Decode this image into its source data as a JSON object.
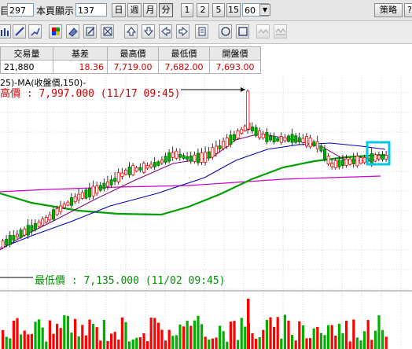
{
  "toolbar": {
    "count_value": "297",
    "page_show_label": "本頁顯示",
    "page_show_value": "137",
    "period_day": "日",
    "period_week": "週",
    "period_month": "月",
    "period_minute": "分",
    "minute_options": [
      "1",
      "2",
      "5",
      "15"
    ],
    "minute_select_value": "60",
    "strategy_label": "策略",
    "help_label": "?"
  },
  "drawing_tools": [
    "bar-chart-icon",
    "pencil-line-icon",
    "pencil-draw-icon",
    "color-palette-icon",
    "eraser-icon",
    "edit-icon",
    "cross-box-icon",
    "arrow-up-icon",
    "arrow-down-icon",
    "arrow-left-icon",
    "arrow-right-icon",
    "document-icon",
    "circle-icon",
    "square-icon",
    "wave-icon-1",
    "wave-icon-2"
  ],
  "stats": {
    "headers": [
      "交易量",
      "基差",
      "最高價",
      "最低價",
      "開盤價"
    ],
    "values": [
      "21,880",
      "18.36",
      "7,719.00",
      "7,682.00",
      "7,693.00"
    ],
    "value_colors": [
      "#000000",
      "#d60000",
      "#d60000",
      "#d60000",
      "#d60000"
    ]
  },
  "chart": {
    "ma_label": "25)-MA(收盤價,150)-",
    "high_label": "高價 : 7,997.000 (11/17 09:45)",
    "low_label": "最低價 : 7,135.000 (11/02 09:45)"
  },
  "colors": {
    "up": "#ff0000",
    "down": "#00b000",
    "ma_short": "#800080",
    "ma_mid": "#0000c0",
    "ma_long": "#00a000",
    "ma_longest": "#d000d0",
    "highlight": "#00c8e8"
  },
  "chart_data": {
    "type": "candlestick",
    "series": [
      {
        "name": "MA(收盤價,150)",
        "values": []
      }
    ],
    "high": {
      "value": 7997.0,
      "time": "11/17 09:45"
    },
    "low": {
      "value": 7135.0,
      "time": "11/02 09:45"
    },
    "grid": true
  }
}
